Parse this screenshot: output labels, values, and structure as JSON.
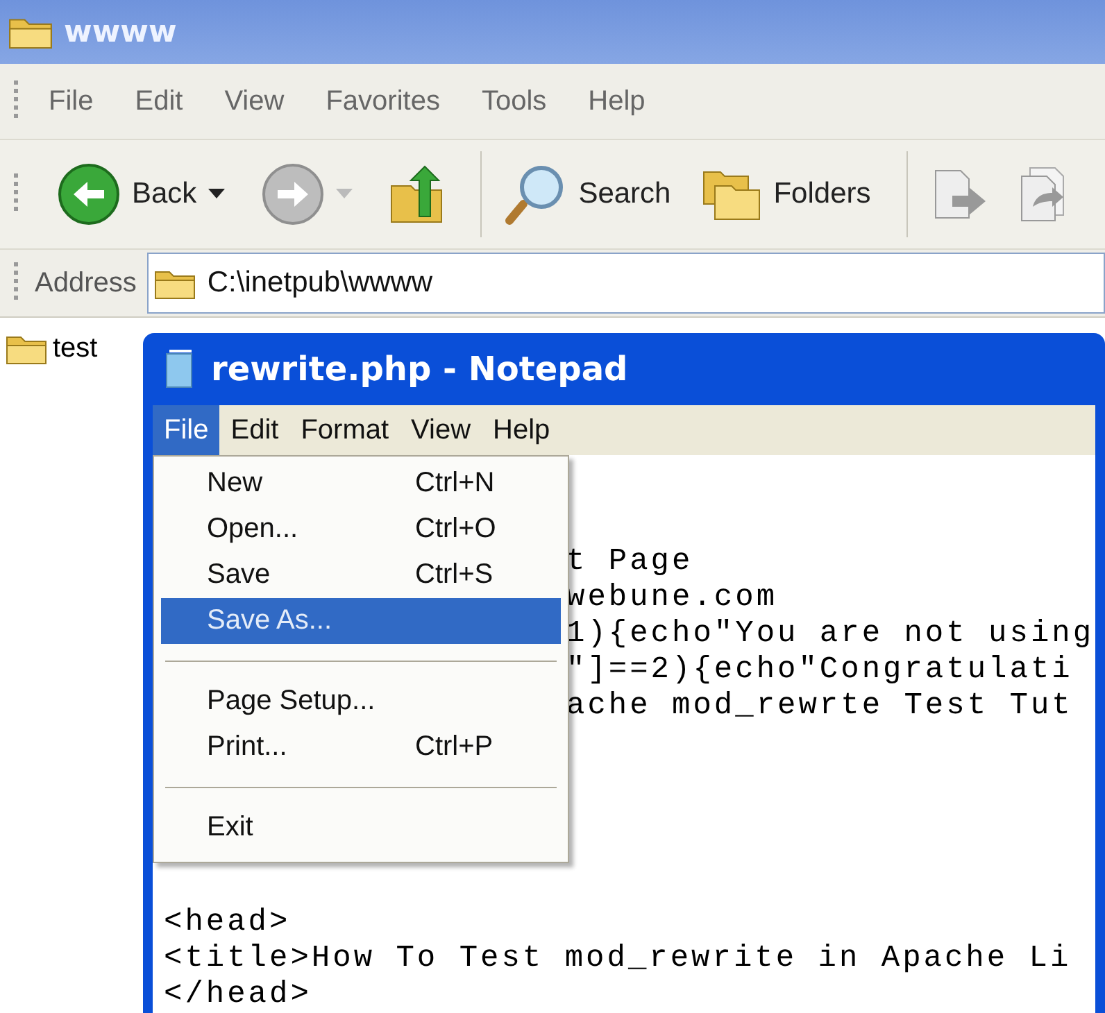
{
  "explorer": {
    "title": "wwww",
    "menu": [
      "File",
      "Edit",
      "View",
      "Favorites",
      "Tools",
      "Help"
    ],
    "toolbar": [
      {
        "kind": "back",
        "label": "Back"
      },
      {
        "kind": "forward"
      },
      {
        "kind": "up"
      },
      {
        "kind": "search",
        "label": "Search"
      },
      {
        "kind": "folders",
        "label": "Folders"
      },
      {
        "kind": "move"
      },
      {
        "kind": "copy"
      }
    ],
    "address": {
      "label": "Address",
      "value": "C:\\inetpub\\wwww"
    },
    "folders": [
      {
        "name": "test"
      }
    ]
  },
  "notepad": {
    "title": "rewrite.php - Notepad",
    "menu": [
      {
        "label": "File",
        "selected": true
      },
      {
        "label": "Edit",
        "selected": false
      },
      {
        "label": "Format",
        "selected": false
      },
      {
        "label": "View",
        "selected": false
      },
      {
        "label": "Help",
        "selected": false
      }
    ],
    "file_menu": [
      {
        "kind": "item",
        "label": "New",
        "shortcut": "Ctrl+N",
        "selected": false
      },
      {
        "kind": "item",
        "label": "Open...",
        "shortcut": "Ctrl+O",
        "selected": false
      },
      {
        "kind": "item",
        "label": "Save",
        "shortcut": "Ctrl+S",
        "selected": false
      },
      {
        "kind": "item",
        "label": "Save As...",
        "selected": true
      },
      {
        "kind": "separator"
      },
      {
        "kind": "item",
        "label": "Page Setup...",
        "selected": false
      },
      {
        "kind": "item",
        "label": "Print...",
        "shortcut": "Ctrl+P",
        "selected": false
      },
      {
        "kind": "separator"
      },
      {
        "kind": "item",
        "label": "Exit",
        "selected": false
      }
    ],
    "lines": [
      {
        "kind": "blank"
      },
      {
        "kind": "blank"
      },
      {
        "kind": "partial",
        "text": "t Page"
      },
      {
        "kind": "partial",
        "text": "webune.com"
      },
      {
        "kind": "partial",
        "text": "1){echo\"You are not using"
      },
      {
        "kind": "partial",
        "text": "\"]==2){echo\"Congratulati"
      },
      {
        "kind": "partial",
        "text": "ache mod_rewrte Test Tut"
      },
      {
        "kind": "blank"
      },
      {
        "kind": "blank"
      },
      {
        "kind": "blank"
      },
      {
        "kind": "blank"
      },
      {
        "kind": "blank"
      },
      {
        "kind": "full",
        "text": "<head>"
      },
      {
        "kind": "full",
        "text": "<title>How To Test mod_rewrite in Apache Li"
      },
      {
        "kind": "full",
        "text": "</head>"
      }
    ]
  }
}
